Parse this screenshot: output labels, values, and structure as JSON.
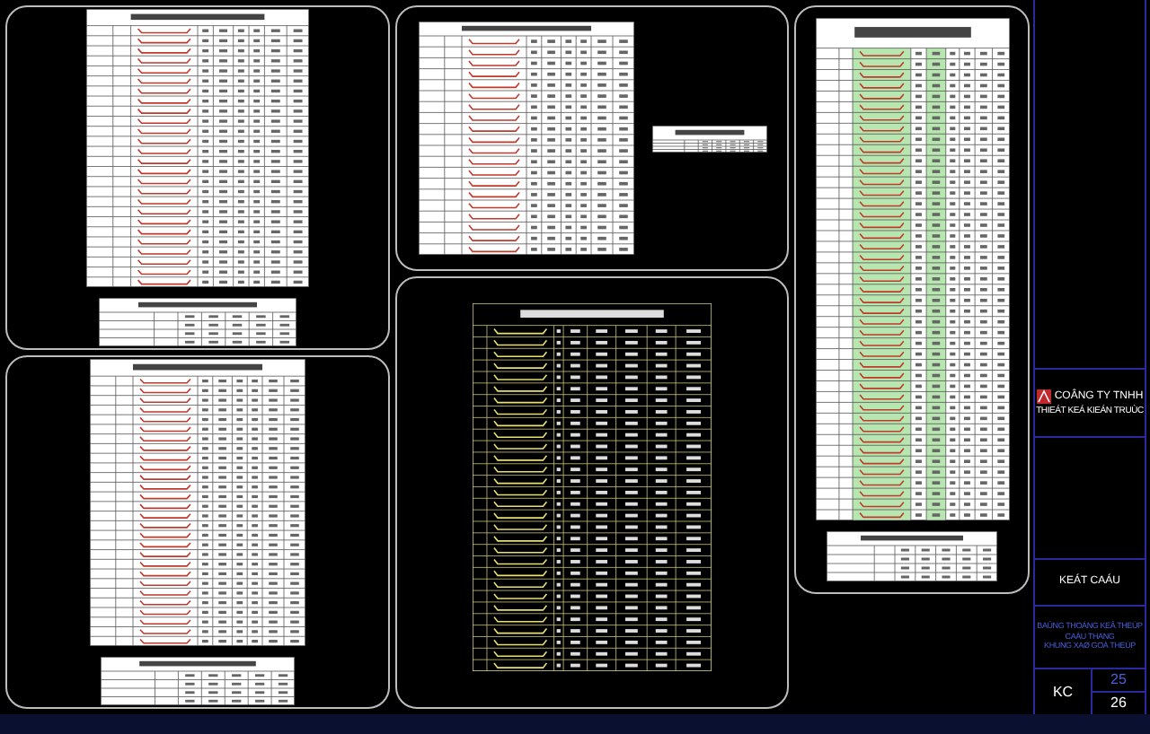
{
  "title_block": {
    "company_name": "COÂNG TY TNHH",
    "company_line2": "THIEÁT KEÁ KIEÁN TRUÙC",
    "section": "KEÁT CAÁU",
    "drawing_title": [
      "BAÛNG THOÁNG KEÂ THEÙP",
      "CAÀU THANG",
      "KHUNG XAØ GOÀ THEÙP"
    ],
    "discipline": "KC",
    "sheet_number": "25",
    "sheet_total": "26"
  }
}
